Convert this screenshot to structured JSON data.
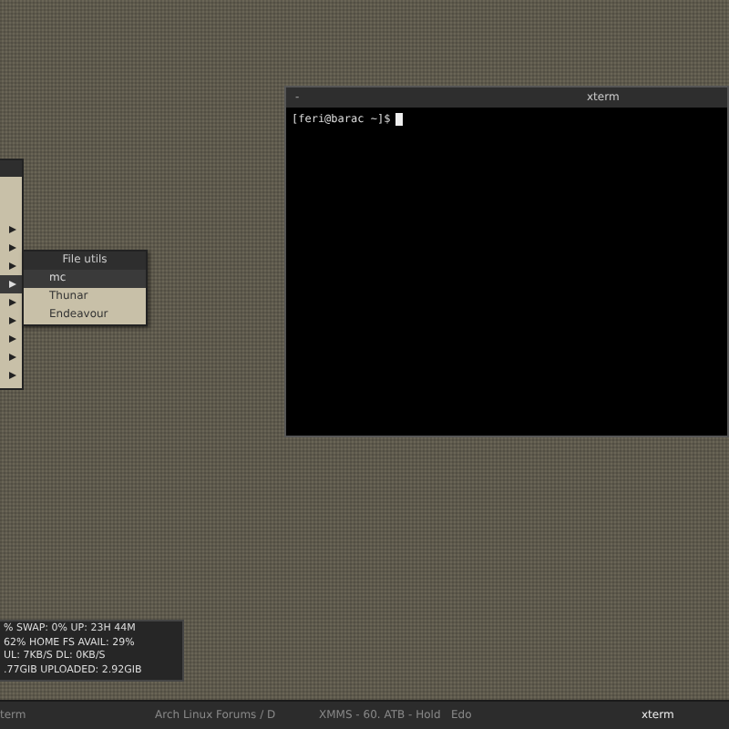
{
  "root_menu": {
    "items": [
      {
        "has_submenu": true,
        "selected": false
      },
      {
        "has_submenu": true,
        "selected": false
      },
      {
        "has_submenu": true,
        "selected": false
      },
      {
        "has_submenu": true,
        "selected": true
      },
      {
        "has_submenu": true,
        "selected": false
      },
      {
        "has_submenu": true,
        "selected": false
      },
      {
        "has_submenu": true,
        "selected": false
      },
      {
        "has_submenu": true,
        "selected": false
      },
      {
        "has_submenu": true,
        "selected": false
      }
    ]
  },
  "submenu": {
    "title": "File utils",
    "items": [
      {
        "label": "mc",
        "selected": true
      },
      {
        "label": "Thunar",
        "selected": false
      },
      {
        "label": "Endeavour",
        "selected": false
      }
    ]
  },
  "terminal": {
    "title": "xterm",
    "button": "-",
    "prompt": "[feri@barac ~]$"
  },
  "conky": {
    "lines": [
      "% SWAP: 0% UP: 23H 44M",
      "62% HOME FS AVAIL: 29%",
      "UL: 7KB/S DL: 0KB/S",
      ".77GIB UPLOADED: 2.92GIB"
    ]
  },
  "taskbar": {
    "items": [
      {
        "label": "term",
        "selected": false
      },
      {
        "label": "Arch Linux Forums / D",
        "selected": false
      },
      {
        "label": "XMMS - 60. ATB - Hold   Edo",
        "selected": false
      },
      {
        "label": "xterm",
        "selected": true
      }
    ]
  }
}
